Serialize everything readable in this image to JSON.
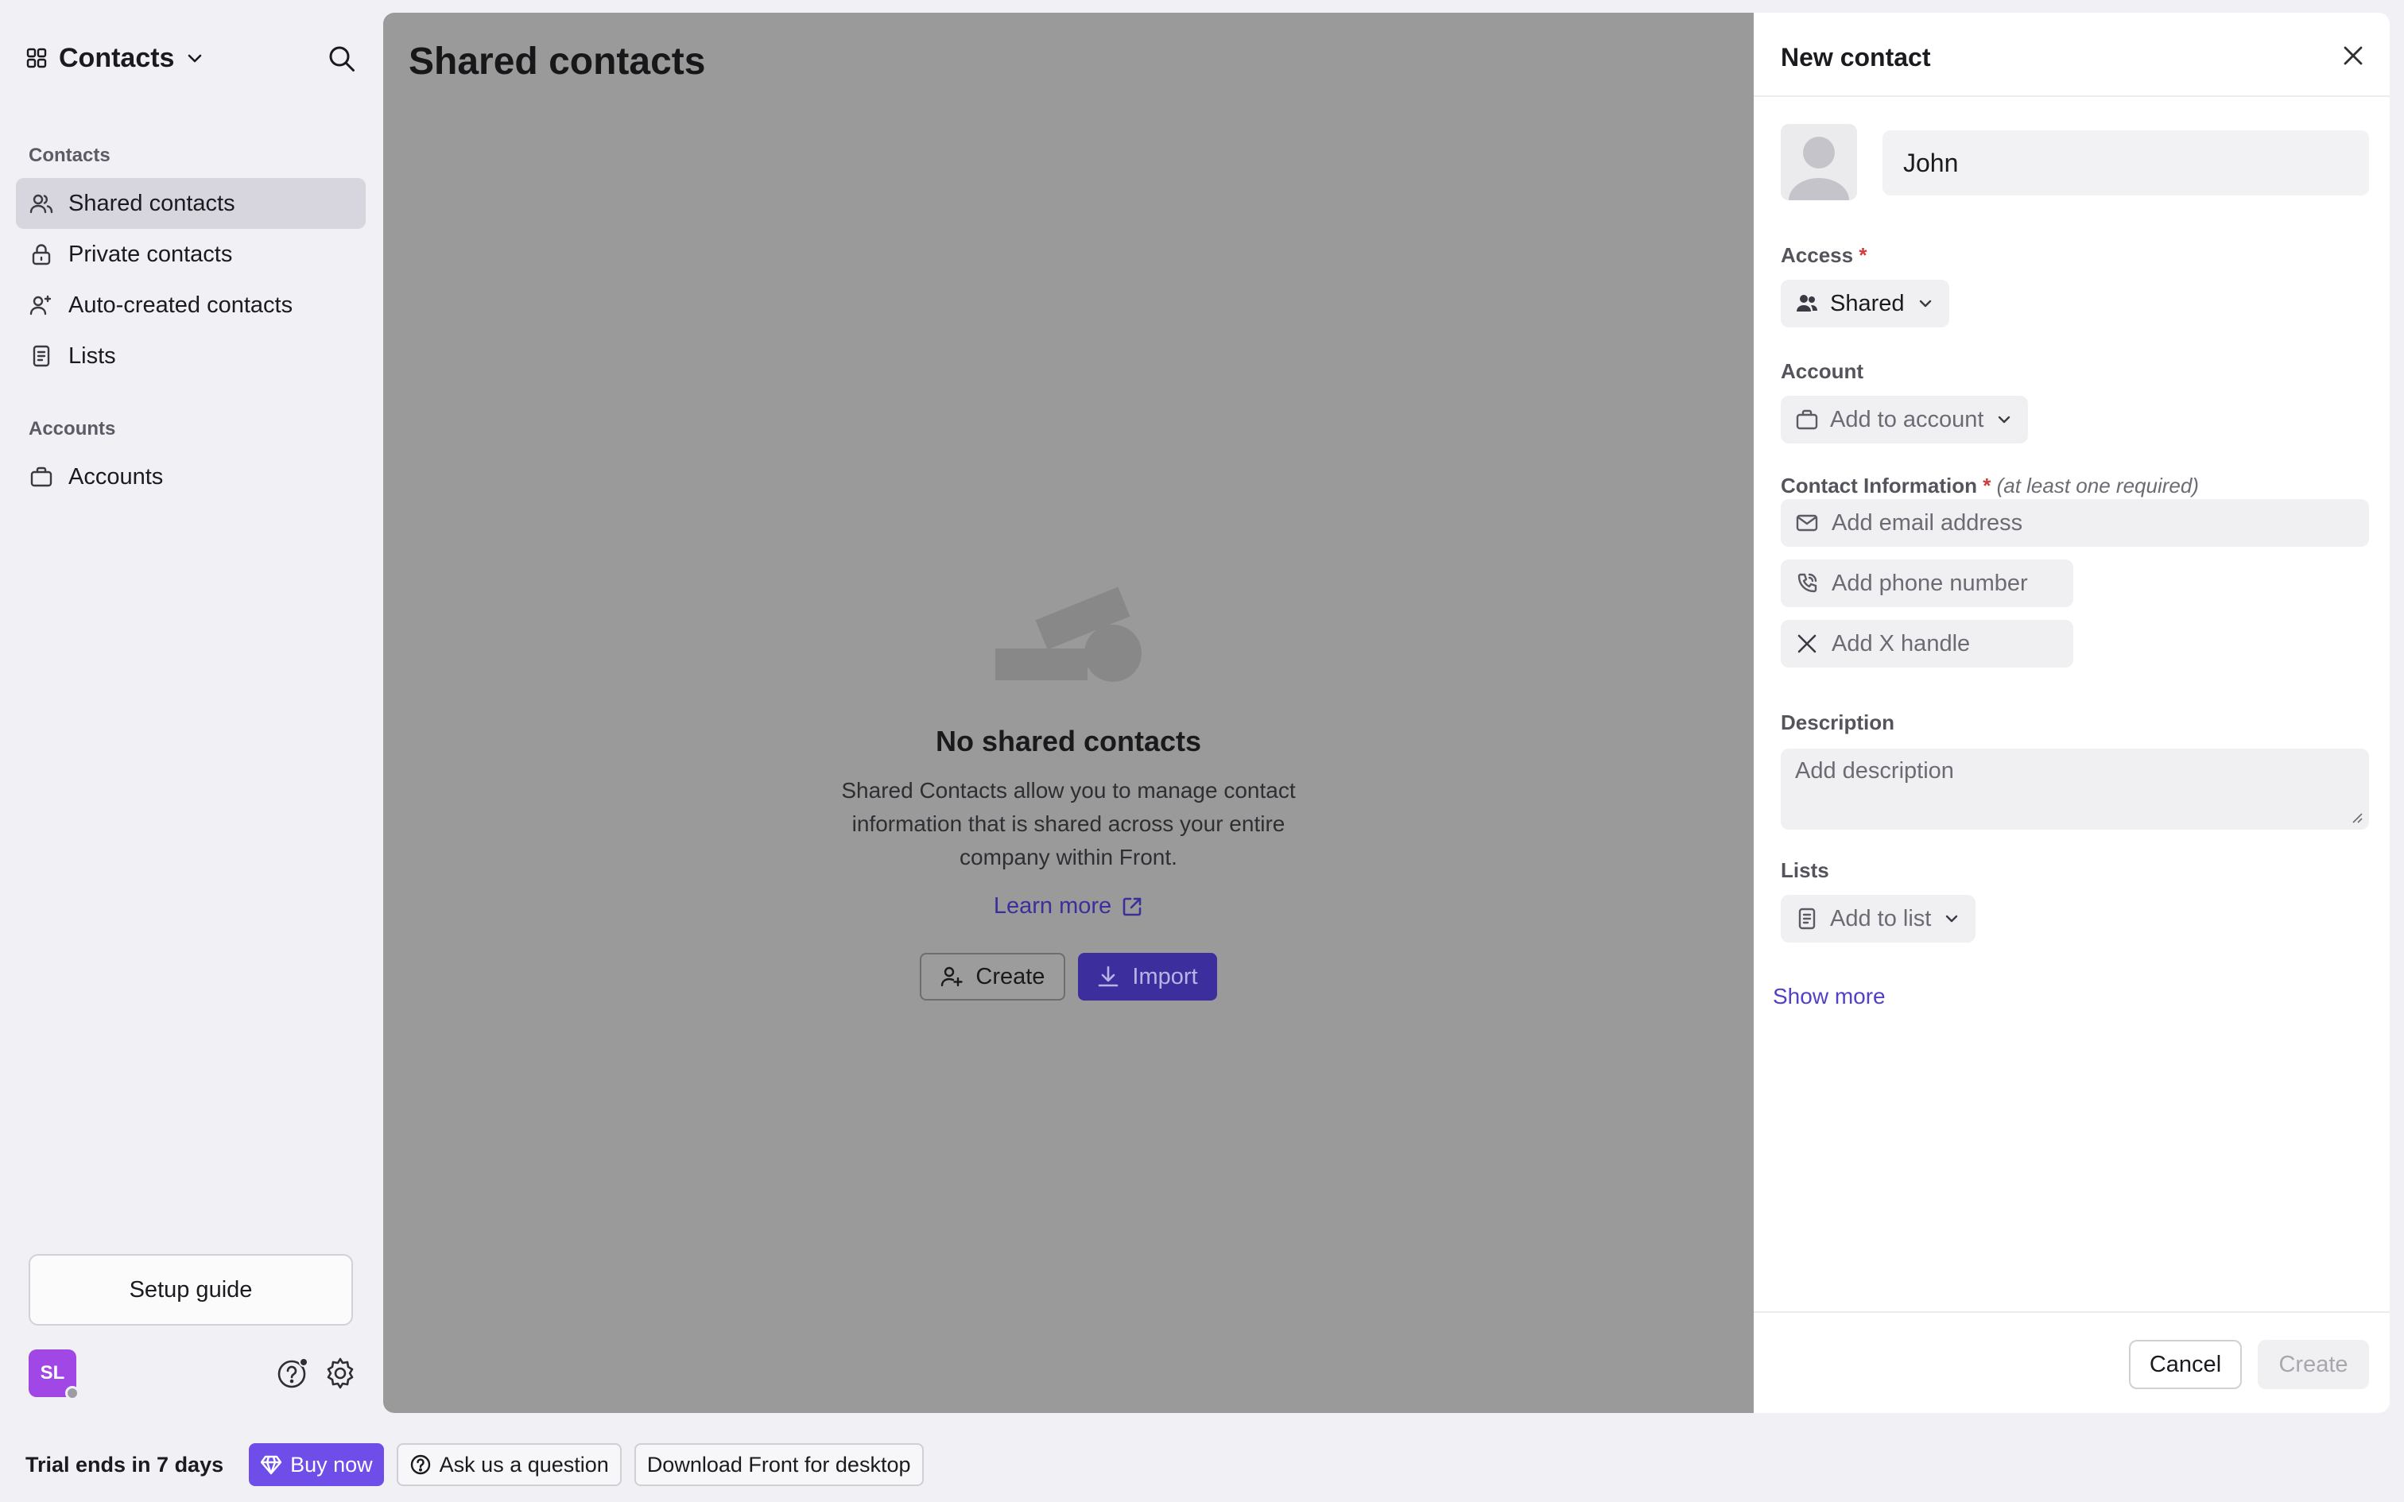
{
  "sidebar": {
    "app_title": "Contacts",
    "groups": [
      {
        "heading": "Contacts",
        "items": [
          {
            "label": "Shared contacts",
            "icon": "users-icon",
            "active": true
          },
          {
            "label": "Private contacts",
            "icon": "lock-icon",
            "active": false
          },
          {
            "label": "Auto-created contacts",
            "icon": "user-sparkle-icon",
            "active": false
          },
          {
            "label": "Lists",
            "icon": "list-doc-icon",
            "active": false
          }
        ]
      },
      {
        "heading": "Accounts",
        "items": [
          {
            "label": "Accounts",
            "icon": "briefcase-icon",
            "active": false
          }
        ]
      }
    ],
    "setup_guide": "Setup guide",
    "avatar_initials": "SL"
  },
  "main": {
    "title": "Shared contacts",
    "empty": {
      "title": "No shared contacts",
      "description": "Shared Contacts allow you to manage contact information that is shared across your entire company within Front.",
      "learn_more": "Learn more",
      "create_label": "Create",
      "import_label": "Import"
    }
  },
  "drawer": {
    "title": "New contact",
    "name_value": "John",
    "access_label": "Access",
    "required_mark": "*",
    "access_value": "Shared",
    "account_label": "Account",
    "account_placeholder": "Add to account",
    "contact_info_label": "Contact Information",
    "contact_info_hint": "(at least one required)",
    "email_placeholder": "Add email address",
    "phone_placeholder": "Add phone number",
    "x_placeholder": "Add X handle",
    "description_label": "Description",
    "description_placeholder": "Add description",
    "lists_label": "Lists",
    "lists_placeholder": "Add to list",
    "show_more": "Show more",
    "cancel_label": "Cancel",
    "create_label": "Create"
  },
  "bottombar": {
    "trial": "Trial ends in 7 days",
    "buy_now": "Buy now",
    "ask": "Ask us a question",
    "download": "Download Front for desktop"
  },
  "colors": {
    "accent": "#3c2f9d",
    "link": "#5140c8",
    "buy": "#6e4de8",
    "avatar": "#a147e6",
    "required": "#d13b3b"
  }
}
